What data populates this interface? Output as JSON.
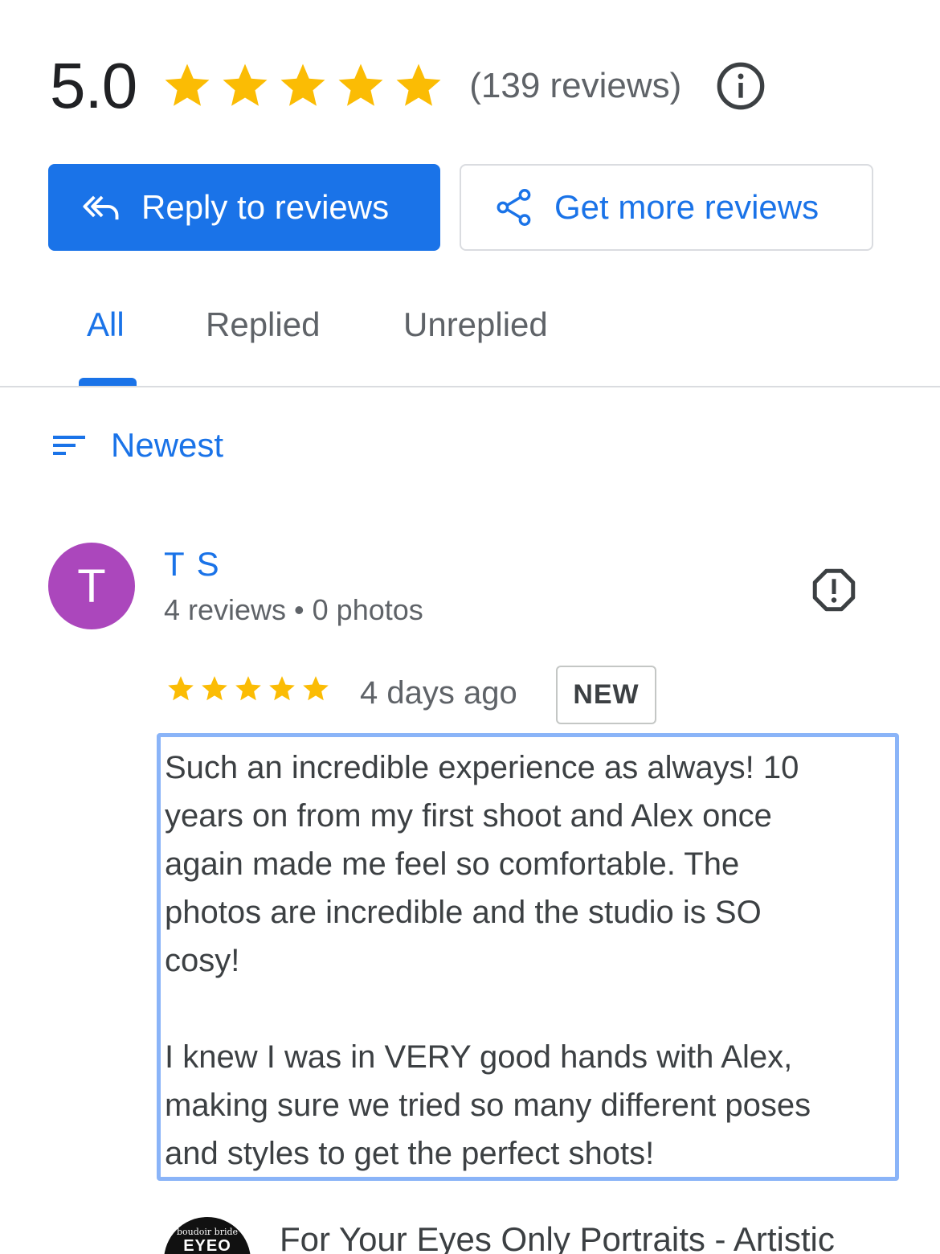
{
  "summary": {
    "rating": "5.0",
    "stars": 5,
    "review_count": "(139 reviews)",
    "star_color": "#fbbc04"
  },
  "actions": {
    "reply_label": "Reply to reviews",
    "get_more_label": "Get more reviews",
    "accent": "#1a73e8"
  },
  "tabs": [
    {
      "label": "All",
      "active": true
    },
    {
      "label": "Replied",
      "active": false
    },
    {
      "label": "Unreplied",
      "active": false
    }
  ],
  "sort": {
    "label": "Newest"
  },
  "review": {
    "avatar_letter": "T",
    "avatar_color": "#ab47bc",
    "name": "T S",
    "meta": "4 reviews • 0 photos",
    "rating": 5,
    "date": "4 days ago",
    "badge": "NEW",
    "text": "Such an incredible experience as always! 10\nyears on from my first shoot and Alex once\nagain made me feel so comfortable. The\nphotos are incredible and the studio is SO\ncosy!\n\nI knew I was in VERY good hands with Alex,\nmaking sure we tried so many different poses\nand styles to get the perfect shots!"
  },
  "owner": {
    "logo_sub": "boudoir bride",
    "logo_main": "EYEO",
    "name": "For Your Eyes Only Portraits - Artistic"
  }
}
